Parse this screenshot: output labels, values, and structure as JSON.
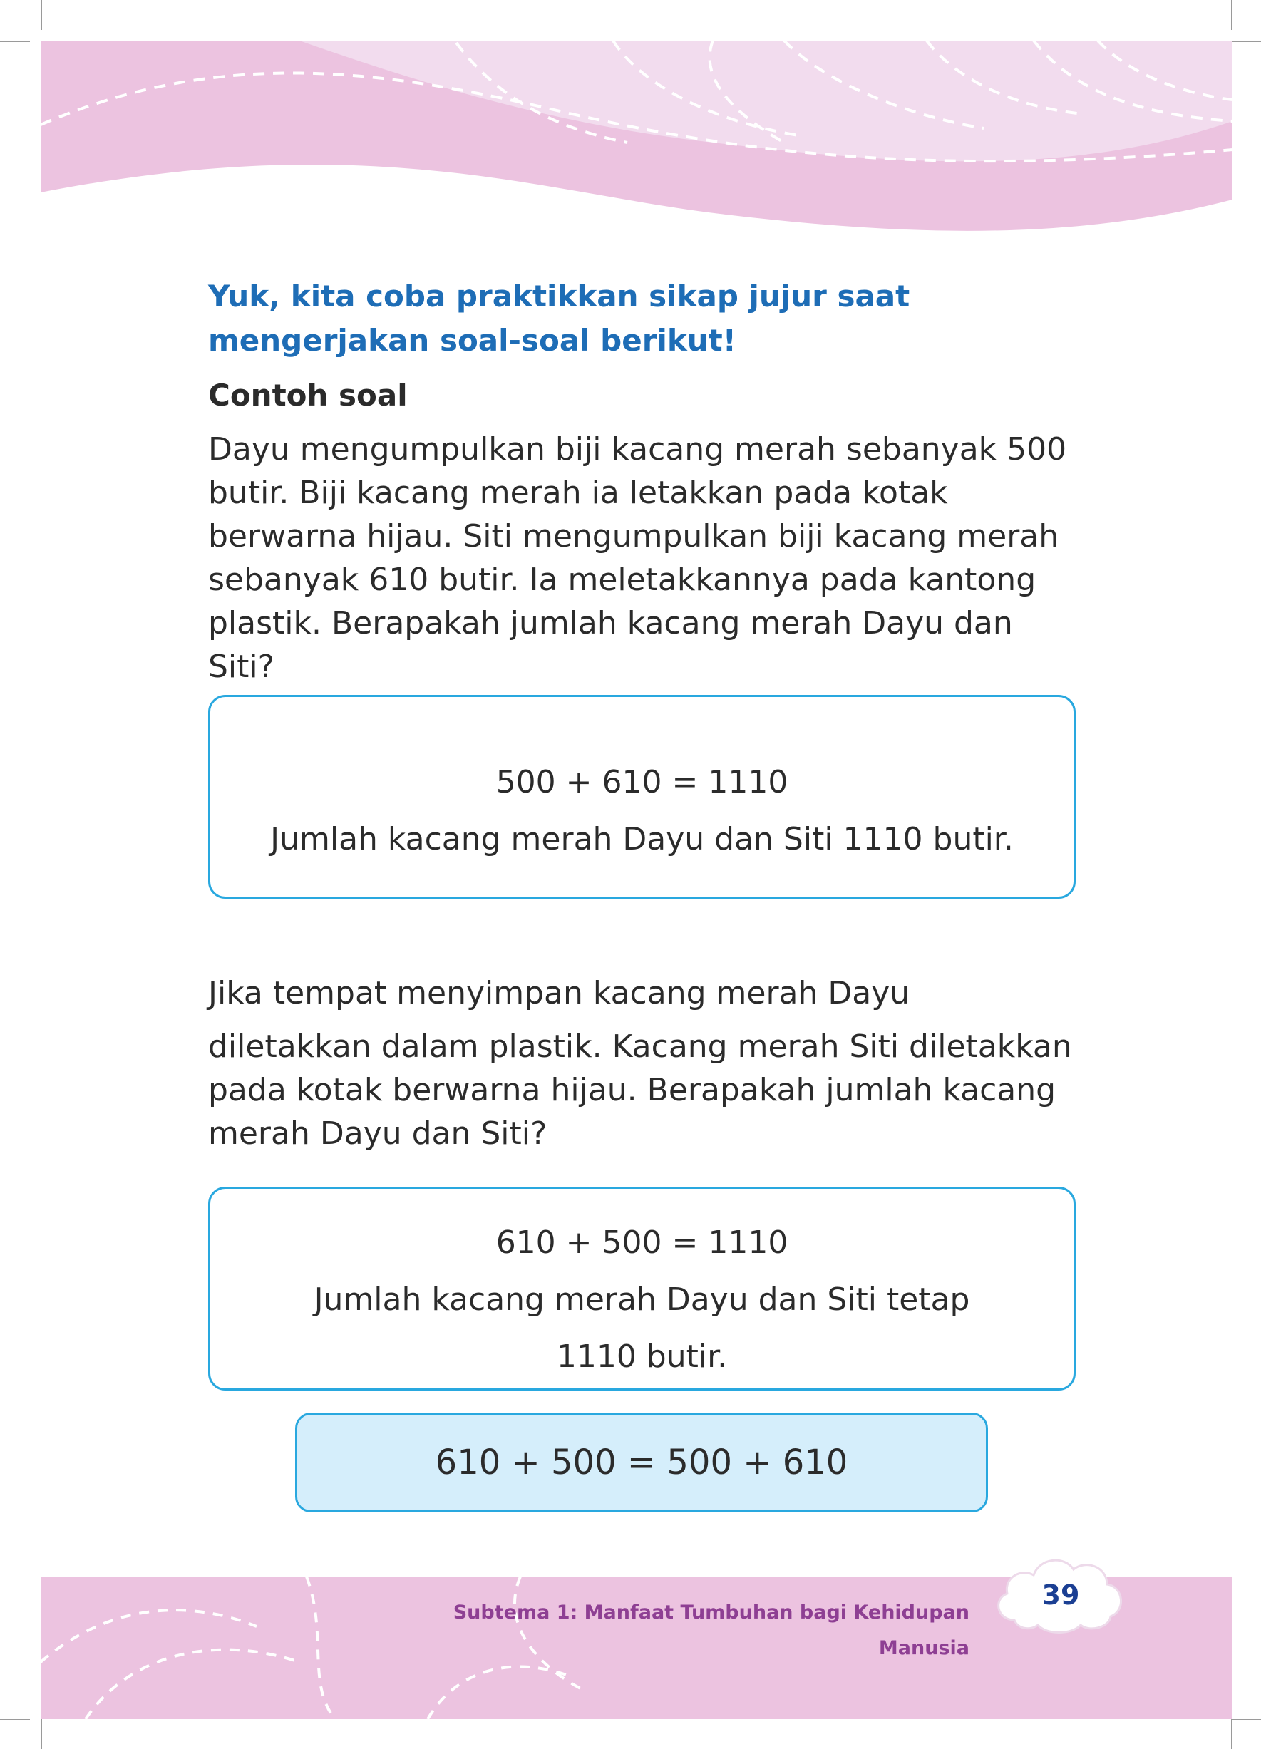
{
  "intro": "Yuk, kita coba praktikkan sikap jujur saat mengerjakan soal-soal berikut!",
  "subheading": "Contoh soal",
  "problem_1": "Dayu mengumpulkan biji kacang merah sebanyak 500 butir. Biji kacang merah ia letakkan pada kotak berwarna hijau. Siti mengumpulkan biji kacang merah sebanyak 610 butir. Ia meletakkannya pada kantong plastik. Berapakah jumlah kacang merah Dayu dan Siti?",
  "answer_1": {
    "equation": "500 + 610 = 1110",
    "statement": "Jumlah kacang merah Dayu dan Siti 1110 butir."
  },
  "problem_2": {
    "line_1": "Jika tempat menyimpan kacang merah Dayu",
    "rest": "diletakkan dalam plastik. Kacang merah Siti diletakkan pada kotak berwarna hijau. Berapakah jumlah kacang merah Dayu dan Siti?"
  },
  "answer_2": {
    "equation": "610 + 500 = 1110",
    "statement": "Jumlah kacang merah Dayu dan Siti tetap 1110 butir."
  },
  "summary": "610 + 500 = 500 + 610",
  "footer": {
    "subtheme": "Subtema 1: Manfaat Tumbuhan bagi Kehidupan Manusia",
    "page_number": "39"
  },
  "colors": {
    "header_pink": "#ecc3e0",
    "header_light": "#f2dcee",
    "intro_blue": "#1e6db6",
    "box_border": "#29a8df",
    "summary_fill": "#d5eefb",
    "footer_text": "#8e3f93",
    "page_number": "#1b3f93"
  }
}
